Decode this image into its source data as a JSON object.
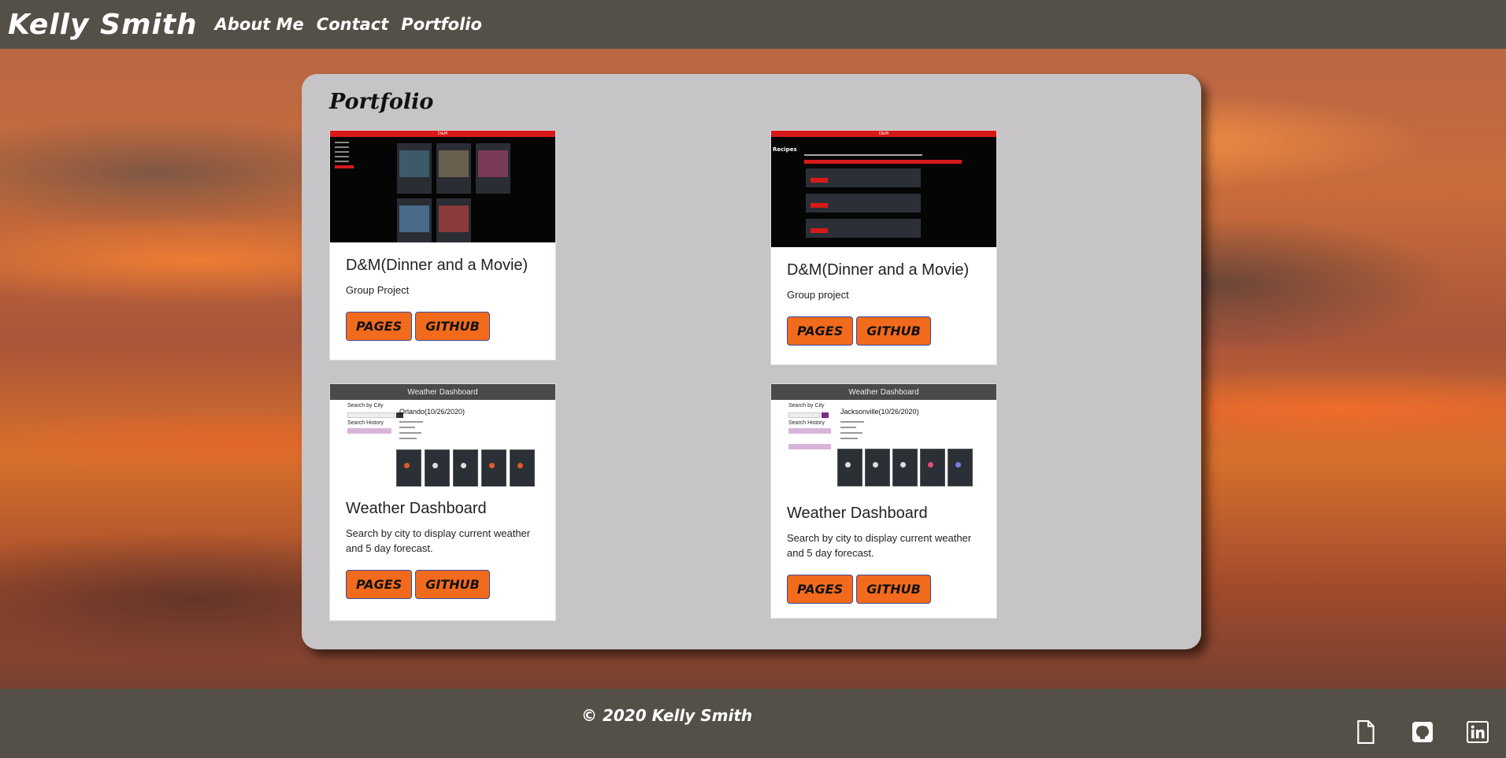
{
  "navbar": {
    "brand": "Kelly Smith",
    "links": [
      "About Me",
      "Contact",
      "Portfolio"
    ]
  },
  "portfolio": {
    "title": "Portfolio",
    "cards": [
      {
        "title": "D&M(Dinner and a Movie)",
        "text": "Group Project",
        "pages_label": "PAGES",
        "github_label": "GITHUB",
        "thumb": {
          "header": "D&M"
        }
      },
      {
        "title": "D&M(Dinner and a Movie)",
        "text": "Group project",
        "pages_label": "PAGES",
        "github_label": "GITHUB",
        "thumb": {
          "header": "D&M",
          "heading": "Recipes"
        }
      },
      {
        "title": "Weather Dashboard",
        "text": "Search by city to display current weather and 5 day forecast.",
        "pages_label": "PAGES",
        "github_label": "GITHUB",
        "thumb": {
          "header": "Weather Dashboard",
          "search_label": "Search by City",
          "history_label": "Search History",
          "city": "Orlando(10/26/2020)"
        }
      },
      {
        "title": "Weather Dashboard",
        "text": "Search by city to display current weather and 5 day forecast.",
        "pages_label": "PAGES",
        "github_label": "GITHUB",
        "thumb": {
          "header": "Weather Dashboard",
          "search_label": "Search by City",
          "history_label": "Search History",
          "city": "Jacksonville(10/26/2020)"
        }
      }
    ]
  },
  "footer": {
    "copyright": "© 2020 Kelly Smith",
    "social": [
      "file-icon",
      "github-icon",
      "linkedin-icon"
    ]
  },
  "colors": {
    "header_bg": "#555047",
    "panel_bg": "#c6c4c6",
    "button_bg": "#f26b1d",
    "thumb_red": "#d7191a"
  }
}
